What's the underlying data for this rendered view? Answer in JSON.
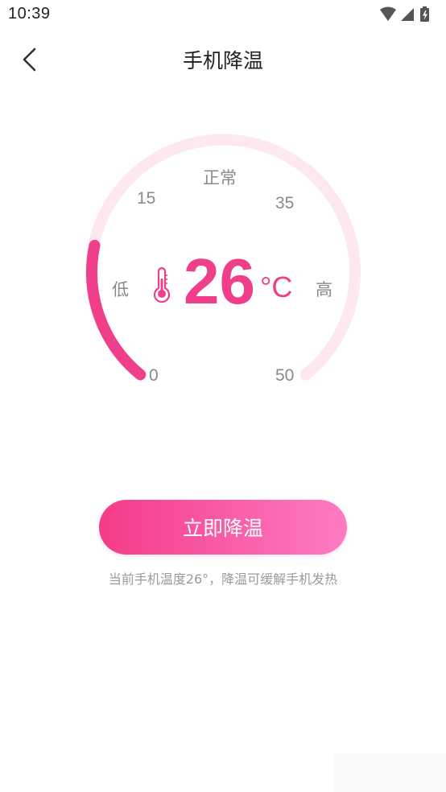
{
  "status_bar": {
    "time": "10:39",
    "icons": [
      "wifi-icon",
      "cell-signal-icon",
      "battery-charging-icon"
    ]
  },
  "header": {
    "title": "手机降温",
    "back_icon": "chevron-left-icon"
  },
  "gauge": {
    "min": 0,
    "max": 50,
    "current": 26,
    "unit": "°C",
    "tick_labels": {
      "t0": "0",
      "t15": "15",
      "t35": "35",
      "t50": "50"
    },
    "zone_labels": {
      "low": "低",
      "normal": "正常",
      "high": "高"
    },
    "progress_fraction": 0.23,
    "track_color": "#fde8f1",
    "progress_color": "#ef3f8b",
    "icon": "thermometer-icon"
  },
  "action": {
    "button_label": "立即降温",
    "hint": "当前手机温度26°，降温可缓解手机发热"
  },
  "colors": {
    "accent": "#ef3f8b",
    "button_gradient_start": "#f43b87",
    "button_gradient_end": "#fd7cc2"
  }
}
